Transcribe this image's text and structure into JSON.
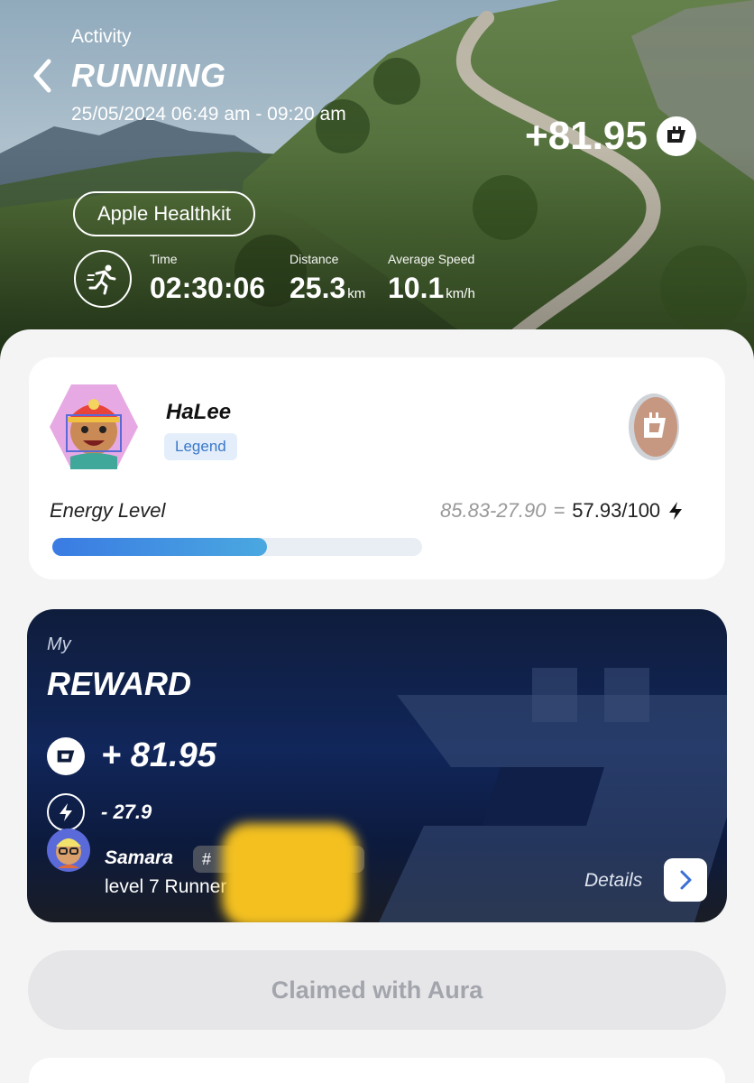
{
  "header": {
    "section_label": "Activity",
    "title": "RUNNING",
    "datetime": "25/05/2024 06:49 am - 09:20 am",
    "reward_total": "+81.95",
    "source": "Apple Healthkit"
  },
  "stats": [
    {
      "label": "Time",
      "value": "02:30:06",
      "unit": ""
    },
    {
      "label": "Distance",
      "value": "25.3",
      "unit": "km"
    },
    {
      "label": "Average Speed",
      "value": "10.1",
      "unit": "km/h"
    }
  ],
  "profile": {
    "name": "HaLee",
    "rank_badge": "Legend",
    "energy_label": "Energy Level",
    "energy_formula": "85.83-27.90",
    "equals": "=",
    "energy_result": "57.93/100",
    "energy_fraction": 0.5793
  },
  "reward_card": {
    "my_label": "My",
    "title": "REWARD",
    "token_amount": "+ 81.95",
    "energy_spent": "- 27.9",
    "claimer_name": "Samara",
    "hash_prefix": "#",
    "claimer_level": "level 7 Runner",
    "details_label": "Details"
  },
  "claim_button": "Claimed with Aura",
  "colors": {
    "accent_blue": "#3a7be3",
    "reward_card_bg": "#11265a",
    "badge_bg": "#e4eefb",
    "badge_text": "#3a78c9"
  },
  "icons": [
    "back-chevron-icon",
    "token-coin-icon",
    "running-icon",
    "lightning-icon",
    "chevron-right-icon"
  ]
}
